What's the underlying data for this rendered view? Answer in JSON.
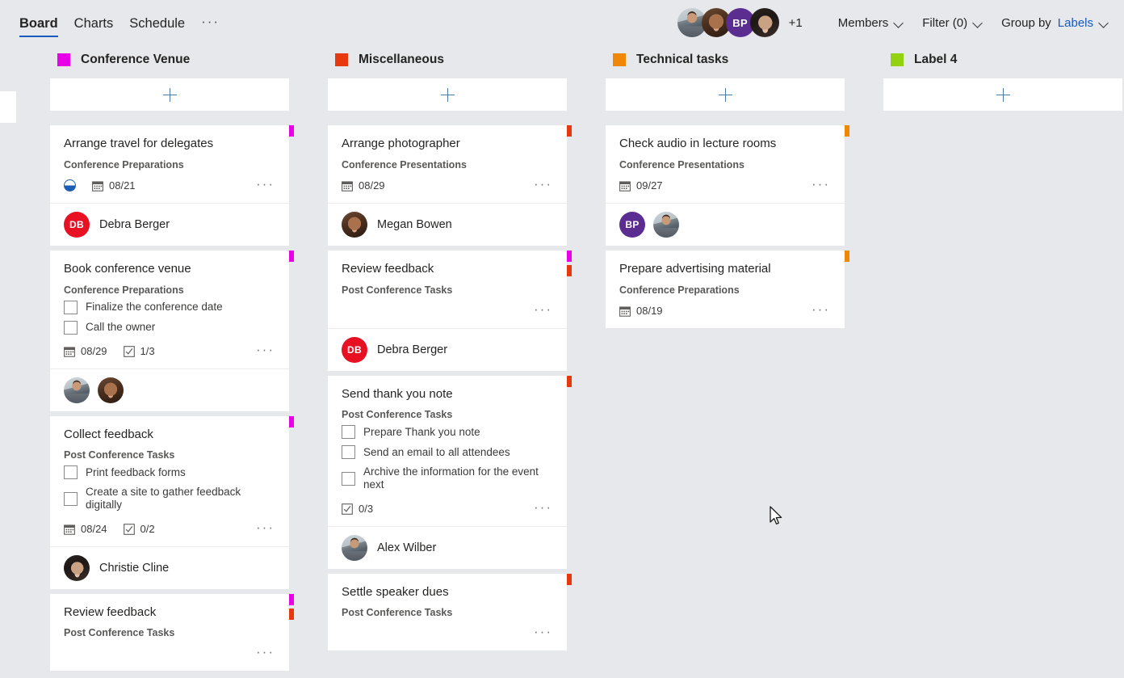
{
  "nav": {
    "tabs": [
      {
        "label": "Board",
        "active": true
      },
      {
        "label": "Charts",
        "active": false
      },
      {
        "label": "Schedule",
        "active": false
      }
    ],
    "more_label": "···"
  },
  "header": {
    "facepile": [
      {
        "name": "Alex Wilber",
        "type": "photo",
        "photo": "ph-alex"
      },
      {
        "name": "Megan Bowen",
        "type": "photo",
        "photo": "ph-megan"
      },
      {
        "name": "BP",
        "type": "initials",
        "initials": "BP",
        "color": "#5B2D90"
      },
      {
        "name": "Christie Cline",
        "type": "photo",
        "photo": "ph-christie"
      }
    ],
    "overflow_count": "+1",
    "members_label": "Members",
    "filter_label": "Filter (0)",
    "group_by_label": "Group by",
    "group_by_value": "Labels"
  },
  "colors": {
    "magenta": "#E800E8",
    "red": "#E8380D",
    "orange": "#F08705",
    "lime": "#93D211",
    "accent": "#185ABD",
    "board_bg": "#E6E8EC",
    "card_bg": "#FFFFFF"
  },
  "add_task_label": "+",
  "buckets": [
    {
      "title": "Conference Venue",
      "swatch": "#E800E8",
      "cards": [
        {
          "title": "Arrange travel for delegates",
          "plan": "Conference Preparations",
          "stripes": [
            "#E800E8"
          ],
          "progress": "in-progress",
          "due": "08/21",
          "checklist": [],
          "checklist_count": null,
          "assignees": [
            {
              "name": "Debra Berger",
              "type": "initials",
              "initials": "DB",
              "color": "#E81123"
            }
          ],
          "show_names": true
        },
        {
          "title": "Book conference venue",
          "plan": "Conference Preparations",
          "stripes": [
            "#E800E8"
          ],
          "progress": null,
          "due": "08/29",
          "checklist": [
            "Finalize the conference date",
            "Call the owner"
          ],
          "checklist_count": "1/3",
          "assignees": [
            {
              "name": "Alex Wilber",
              "type": "photo",
              "photo": "ph-alex"
            },
            {
              "name": "Megan Bowen",
              "type": "photo",
              "photo": "ph-megan"
            }
          ],
          "show_names": false
        },
        {
          "title": "Collect feedback",
          "plan": "Post Conference Tasks",
          "stripes": [
            "#E800E8"
          ],
          "progress": null,
          "due": "08/24",
          "checklist": [
            "Print feedback forms",
            "Create a site to gather feedback digitally"
          ],
          "checklist_count": "0/2",
          "assignees": [
            {
              "name": "Christie Cline",
              "type": "photo",
              "photo": "ph-christie"
            }
          ],
          "show_names": true
        },
        {
          "title": "Review feedback",
          "plan": "Post Conference Tasks",
          "stripes": [
            "#E800E8",
            "#E8380D"
          ],
          "progress": null,
          "due": null,
          "checklist": [],
          "checklist_count": null,
          "assignees": [],
          "show_names": false
        }
      ]
    },
    {
      "title": "Miscellaneous",
      "swatch": "#E8380D",
      "cards": [
        {
          "title": "Arrange photographer",
          "plan": "Conference Presentations",
          "stripes": [
            "#E8380D"
          ],
          "progress": null,
          "due": "08/29",
          "checklist": [],
          "checklist_count": null,
          "assignees": [
            {
              "name": "Megan Bowen",
              "type": "photo",
              "photo": "ph-megan"
            }
          ],
          "show_names": true
        },
        {
          "title": "Review feedback",
          "plan": "Post Conference Tasks",
          "stripes": [
            "#E800E8",
            "#E8380D"
          ],
          "progress": null,
          "due": null,
          "checklist": [],
          "checklist_count": null,
          "assignees": [
            {
              "name": "Debra Berger",
              "type": "initials",
              "initials": "DB",
              "color": "#E81123"
            }
          ],
          "show_names": true
        },
        {
          "title": "Send thank you note",
          "plan": "Post Conference Tasks",
          "stripes": [
            "#E8380D"
          ],
          "progress": null,
          "due": null,
          "checklist": [
            "Prepare Thank you note",
            "Send an email to all attendees",
            "Archive the information for the event next"
          ],
          "checklist_count": "0/3",
          "assignees": [
            {
              "name": "Alex Wilber",
              "type": "photo",
              "photo": "ph-alex"
            }
          ],
          "show_names": true
        },
        {
          "title": "Settle speaker dues",
          "plan": "Post Conference Tasks",
          "stripes": [
            "#E8380D"
          ],
          "progress": null,
          "due": null,
          "checklist": [],
          "checklist_count": null,
          "assignees": [],
          "show_names": false
        }
      ]
    },
    {
      "title": "Technical tasks",
      "swatch": "#F08705",
      "cards": [
        {
          "title": "Check audio in lecture rooms",
          "plan": "Conference Presentations",
          "stripes": [
            "#F08705"
          ],
          "progress": null,
          "due": "09/27",
          "checklist": [],
          "checklist_count": null,
          "assignees": [
            {
              "name": "BP",
              "type": "initials",
              "initials": "BP",
              "color": "#5B2D90"
            },
            {
              "name": "Alex Wilber",
              "type": "photo",
              "photo": "ph-alex"
            }
          ],
          "show_names": false
        },
        {
          "title": "Prepare advertising material",
          "plan": "Conference Preparations",
          "stripes": [
            "#F08705"
          ],
          "progress": null,
          "due": "08/19",
          "checklist": [],
          "checklist_count": null,
          "assignees": [],
          "show_names": false
        }
      ]
    },
    {
      "title": "Label 4",
      "swatch": "#93D211",
      "cards": []
    }
  ]
}
